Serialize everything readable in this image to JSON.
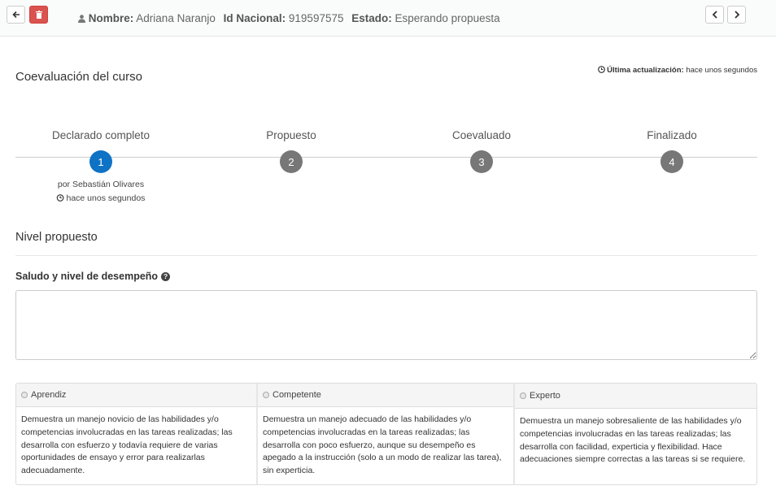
{
  "header": {
    "nombre_label": "Nombre:",
    "nombre_value": "Adriana Naranjo",
    "id_label": "Id Nacional:",
    "id_value": "919597575",
    "estado_label": "Estado:",
    "estado_value": "Esperando propuesta",
    "icons": [
      "arrow-left-icon",
      "trash-icon",
      "user-icon",
      "chevron-left-icon",
      "chevron-right-icon"
    ]
  },
  "main": {
    "title": "Coevaluación del curso",
    "updated_label": "Última actualización:",
    "updated_value": "hace unos segundos"
  },
  "steps": [
    {
      "label": "Declarado completo",
      "number": "1",
      "active": true
    },
    {
      "label": "Propuesto",
      "number": "2",
      "active": false
    },
    {
      "label": "Coevaluado",
      "number": "3",
      "active": false
    },
    {
      "label": "Finalizado",
      "number": "4",
      "active": false
    }
  ],
  "step_meta": {
    "by": "por Sebastián Olivares",
    "when": "hace unos segundos"
  },
  "nivel": {
    "title": "Nivel propuesto",
    "field_label": "Saludo y nivel de desempeño",
    "textarea_value": ""
  },
  "levels": [
    {
      "name": "Aprendiz",
      "description": "Demuestra un manejo novicio de las habilidades y/o competencias involucradas en las tareas realizadas; las desarrolla con esfuerzo y todavía requiere de varias oportunidades de ensayo y error para realizarlas adecuadamente."
    },
    {
      "name": "Competente",
      "description": "Demuestra un manejo adecuado de las habilidades y/o competencias involucradas en la tareas realizadas; las desarrolla con poco esfuerzo, aunque su desempeño es apegado a la instrucción (solo a un modo de realizar las tarea), sin experticia."
    },
    {
      "name": "Experto",
      "description": "Demuestra un manejo sobresaliente de las habilidades y/o competencias involucradas en las tareas realizadas; las desarrolla con facilidad, experticia y flexibilidad. Hace adecuaciones siempre correctas a las tareas si se requiere."
    }
  ],
  "colors": {
    "accent": "#0e72c5",
    "step_inactive": "#777777",
    "danger": "#d9534f"
  }
}
